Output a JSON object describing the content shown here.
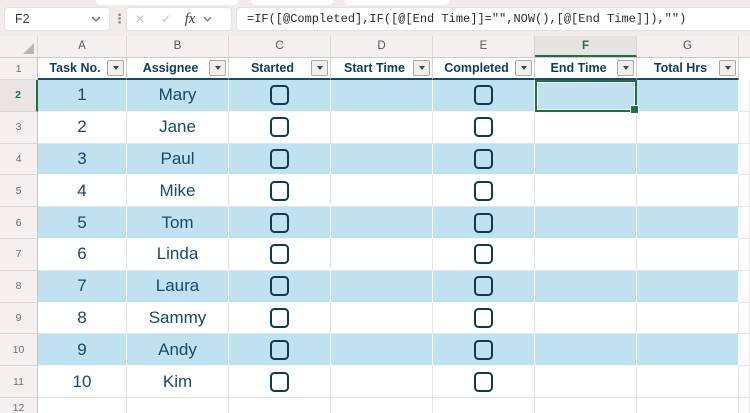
{
  "formula_bar": {
    "name_box_value": "F2",
    "fx_label": "fx",
    "cancel_glyph": "✕",
    "enter_glyph": "✓",
    "formula": "=IF([@Completed],IF([@[End Time]]=\"\",NOW(),[@[End Time]]),\"\")"
  },
  "grid": {
    "column_letters": [
      "A",
      "B",
      "C",
      "D",
      "E",
      "F",
      "G"
    ],
    "selected_column": "F",
    "selected_cell": "F2",
    "header_row_number": "1",
    "partial_row_number": "12",
    "table_headers": [
      "Task No.",
      "Assignee",
      "Started",
      "Start Time",
      "Completed",
      "End Time",
      "Total Hrs"
    ],
    "rows": [
      {
        "row_number": "2",
        "task_no": "1",
        "assignee": "Mary",
        "started_checked": false,
        "completed_checked": false,
        "banded": true
      },
      {
        "row_number": "3",
        "task_no": "2",
        "assignee": "Jane",
        "started_checked": false,
        "completed_checked": false,
        "banded": false
      },
      {
        "row_number": "4",
        "task_no": "3",
        "assignee": "Paul",
        "started_checked": false,
        "completed_checked": false,
        "banded": true
      },
      {
        "row_number": "5",
        "task_no": "4",
        "assignee": "Mike",
        "started_checked": false,
        "completed_checked": false,
        "banded": false
      },
      {
        "row_number": "6",
        "task_no": "5",
        "assignee": "Tom",
        "started_checked": false,
        "completed_checked": false,
        "banded": true
      },
      {
        "row_number": "7",
        "task_no": "6",
        "assignee": "Linda",
        "started_checked": false,
        "completed_checked": false,
        "banded": false
      },
      {
        "row_number": "8",
        "task_no": "7",
        "assignee": "Laura",
        "started_checked": false,
        "completed_checked": false,
        "banded": true
      },
      {
        "row_number": "9",
        "task_no": "8",
        "assignee": "Sammy",
        "started_checked": false,
        "completed_checked": false,
        "banded": false
      },
      {
        "row_number": "10",
        "task_no": "9",
        "assignee": "Andy",
        "started_checked": false,
        "completed_checked": false,
        "banded": true
      },
      {
        "row_number": "11",
        "task_no": "10",
        "assignee": "Kim",
        "started_checked": false,
        "completed_checked": false,
        "banded": false
      }
    ]
  },
  "colors": {
    "selection_green": "#1E7145",
    "band_blue": "#BFE1F0",
    "data_text_navy": "#1A4A66",
    "header_text_navy": "#0F3D5A",
    "table_border_navy": "#1B4A63",
    "checkbox_border": "#0E3A52",
    "chrome_background": "#F1ECEB"
  }
}
